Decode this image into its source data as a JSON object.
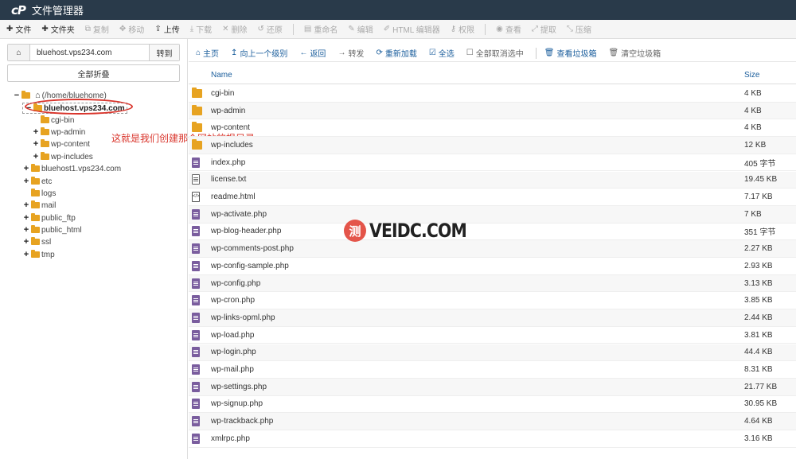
{
  "app": {
    "logo": "cP",
    "title": "文件管理器"
  },
  "toolbar": [
    {
      "icon": "plus-icon",
      "glyph": "✚",
      "label": "文件",
      "enabled": true
    },
    {
      "icon": "plus-icon",
      "glyph": "✚",
      "label": "文件夹",
      "enabled": true
    },
    {
      "icon": "copy-icon",
      "glyph": "⧉",
      "label": "复制",
      "enabled": false
    },
    {
      "icon": "move-icon",
      "glyph": "✥",
      "label": "移动",
      "enabled": false
    },
    {
      "icon": "upload-icon",
      "glyph": "⇪",
      "label": "上传",
      "enabled": true
    },
    {
      "icon": "download-icon",
      "glyph": "⤓",
      "label": "下载",
      "enabled": false
    },
    {
      "icon": "delete-icon",
      "glyph": "✕",
      "label": "删除",
      "enabled": false
    },
    {
      "icon": "restore-icon",
      "glyph": "↺",
      "label": "还原",
      "enabled": false
    },
    {
      "icon": "rename-icon",
      "glyph": "▤",
      "label": "重命名",
      "enabled": false
    },
    {
      "icon": "edit-icon",
      "glyph": "✎",
      "label": "编辑",
      "enabled": false
    },
    {
      "icon": "html-editor-icon",
      "glyph": "✐",
      "label": "HTML 编辑器",
      "enabled": false
    },
    {
      "icon": "key-icon",
      "glyph": "⚷",
      "label": "权限",
      "enabled": false
    },
    {
      "icon": "view-icon",
      "glyph": "◉",
      "label": "查看",
      "enabled": false
    },
    {
      "icon": "extract-icon",
      "glyph": "⤢",
      "label": "提取",
      "enabled": false
    },
    {
      "icon": "compress-icon",
      "glyph": "⤡",
      "label": "压缩",
      "enabled": false
    }
  ],
  "left": {
    "address": "bluehost.vps234.com",
    "go_label": "转到",
    "collapse_all_label": "全部折叠",
    "tree": [
      {
        "toggle": "−",
        "label": "(/home/bluehome)",
        "icon": "home",
        "level": 0
      },
      {
        "toggle": "−",
        "label": "bluehost.vps234.com",
        "icon": "folder",
        "level": 1,
        "selected": true
      },
      {
        "toggle": "",
        "label": "cgi-bin",
        "icon": "folder",
        "level": 2
      },
      {
        "toggle": "+",
        "label": "wp-admin",
        "icon": "folder",
        "level": 2
      },
      {
        "toggle": "+",
        "label": "wp-content",
        "icon": "folder",
        "level": 2
      },
      {
        "toggle": "+",
        "label": "wp-includes",
        "icon": "folder",
        "level": 2
      },
      {
        "toggle": "+",
        "label": "bluehost1.vps234.com",
        "icon": "folder",
        "level": 1
      },
      {
        "toggle": "+",
        "label": "etc",
        "icon": "folder",
        "level": 1
      },
      {
        "toggle": "",
        "label": "logs",
        "icon": "folder",
        "level": 1
      },
      {
        "toggle": "+",
        "label": "mail",
        "icon": "folder",
        "level": 1
      },
      {
        "toggle": "+",
        "label": "public_ftp",
        "icon": "folder",
        "level": 1
      },
      {
        "toggle": "+",
        "label": "public_html",
        "icon": "folder",
        "level": 1
      },
      {
        "toggle": "+",
        "label": "ssl",
        "icon": "folder",
        "level": 1
      },
      {
        "toggle": "+",
        "label": "tmp",
        "icon": "folder",
        "level": 1
      }
    ]
  },
  "annotation": "这就是我们创建那个网站的根目录",
  "nav": [
    {
      "icon": "home-icon",
      "glyph": "⌂",
      "label": "主页",
      "enabled": true
    },
    {
      "icon": "up-level-icon",
      "glyph": "↥",
      "label": "向上一个级别",
      "enabled": true
    },
    {
      "icon": "back-icon",
      "glyph": "←",
      "label": "返回",
      "enabled": true
    },
    {
      "icon": "forward-icon",
      "glyph": "→",
      "label": "转发",
      "enabled": false
    },
    {
      "icon": "reload-icon",
      "glyph": "⟳",
      "label": "重新加载",
      "enabled": true
    },
    {
      "icon": "select-all-icon",
      "glyph": "☑",
      "label": "全选",
      "enabled": true
    },
    {
      "icon": "unselect-icon",
      "glyph": "☐",
      "label": "全部取消选中",
      "enabled": false
    },
    {
      "icon": "trash-icon",
      "glyph": "🗑",
      "label": "查看垃圾箱",
      "enabled": true
    },
    {
      "icon": "trash-empty-icon",
      "glyph": "🗑",
      "label": "清空垃圾箱",
      "enabled": false
    }
  ],
  "table": {
    "col_name": "Name",
    "col_size": "Size",
    "rows": [
      {
        "type": "folder",
        "name": "cgi-bin",
        "size": "4 KB"
      },
      {
        "type": "folder",
        "name": "wp-admin",
        "size": "4 KB"
      },
      {
        "type": "folder",
        "name": "wp-content",
        "size": "4 KB"
      },
      {
        "type": "folder",
        "name": "wp-includes",
        "size": "12 KB"
      },
      {
        "type": "php",
        "name": "index.php",
        "size": "405 字节"
      },
      {
        "type": "doc",
        "name": "license.txt",
        "size": "19.45 KB"
      },
      {
        "type": "html",
        "name": "readme.html",
        "size": "7.17 KB"
      },
      {
        "type": "php",
        "name": "wp-activate.php",
        "size": "7 KB"
      },
      {
        "type": "php",
        "name": "wp-blog-header.php",
        "size": "351 字节"
      },
      {
        "type": "php",
        "name": "wp-comments-post.php",
        "size": "2.27 KB"
      },
      {
        "type": "php",
        "name": "wp-config-sample.php",
        "size": "2.93 KB"
      },
      {
        "type": "php",
        "name": "wp-config.php",
        "size": "3.13 KB"
      },
      {
        "type": "php",
        "name": "wp-cron.php",
        "size": "3.85 KB"
      },
      {
        "type": "php",
        "name": "wp-links-opml.php",
        "size": "2.44 KB"
      },
      {
        "type": "php",
        "name": "wp-load.php",
        "size": "3.81 KB"
      },
      {
        "type": "php",
        "name": "wp-login.php",
        "size": "44.4 KB"
      },
      {
        "type": "php",
        "name": "wp-mail.php",
        "size": "8.31 KB"
      },
      {
        "type": "php",
        "name": "wp-settings.php",
        "size": "21.77 KB"
      },
      {
        "type": "php",
        "name": "wp-signup.php",
        "size": "30.95 KB"
      },
      {
        "type": "php",
        "name": "wp-trackback.php",
        "size": "4.64 KB"
      },
      {
        "type": "php",
        "name": "xmlrpc.php",
        "size": "3.16 KB"
      }
    ]
  },
  "watermark": {
    "badge": "测",
    "text": "VEIDC.COM"
  }
}
